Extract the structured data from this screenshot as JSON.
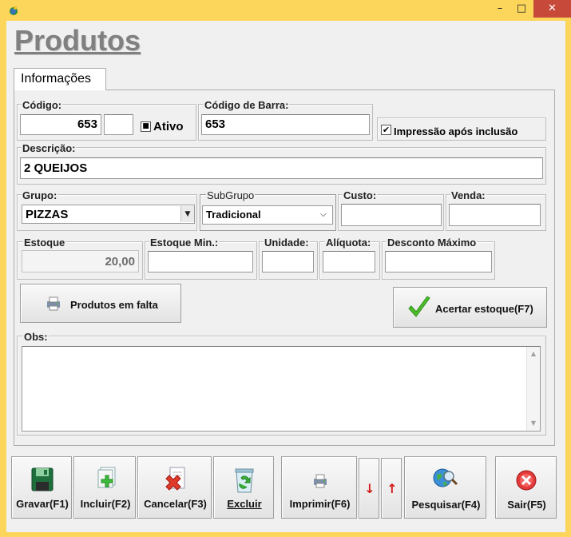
{
  "window": {
    "minimize": "–",
    "maximize": "□",
    "close": "✕"
  },
  "title": "Produtos",
  "tabs": [
    {
      "label": "Informações"
    }
  ],
  "codigo": {
    "label": "Código:",
    "value": "653",
    "ativo_label": "Ativo",
    "ativo_checked": true
  },
  "codigo_barra": {
    "label": "Código de Barra:",
    "value": "653"
  },
  "impressao": {
    "label": "Impressão após inclusão",
    "checked": true
  },
  "descricao": {
    "label": "Descrição:",
    "value": "2 QUEIJOS"
  },
  "grupo": {
    "label": "Grupo:",
    "value": "PIZZAS"
  },
  "subgrupo": {
    "label": "SubGrupo",
    "value": "Tradicional"
  },
  "custo": {
    "label": "Custo:",
    "value": ""
  },
  "venda": {
    "label": "Venda:",
    "value": ""
  },
  "estoque": {
    "label": "Estoque",
    "value": "20,00"
  },
  "estoque_min": {
    "label": "Estoque Min.:",
    "value": ""
  },
  "unidade": {
    "label": "Unidade:",
    "value": ""
  },
  "aliquota": {
    "label": "Alíquota:",
    "value": ""
  },
  "desconto": {
    "label": "Desconto Máximo",
    "value": ""
  },
  "buttons": {
    "produtos_falta": "Produtos em falta",
    "acertar_estoque": "Acertar estoque(F7)"
  },
  "obs": {
    "label": "Obs:",
    "value": ""
  },
  "toolbar": {
    "gravar": "Gravar(F1)",
    "incluir": "Incluir(F2)",
    "cancelar": "Cancelar(F3)",
    "excluir": "Excluir",
    "imprimir": "Imprimir(F6)",
    "down": "↓",
    "up": "↑",
    "pesquisar": "Pesquisar(F4)",
    "sair": "Sair(F5)"
  },
  "colors": {
    "titlebar": "#fbd65b",
    "close_button": "#c7493a",
    "window_bg": "#f0f0f0",
    "title_text": "#808080"
  }
}
